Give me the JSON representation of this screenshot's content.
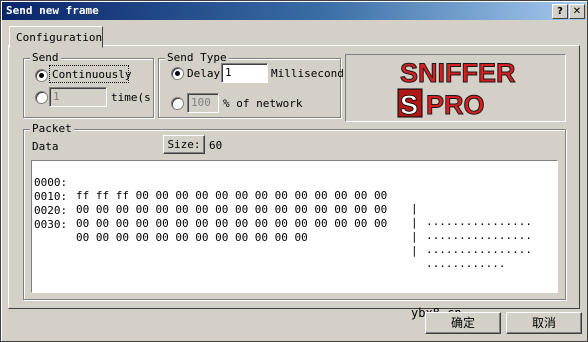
{
  "window": {
    "title": "Send new frame",
    "help_btn": "?",
    "close_btn": "✕"
  },
  "tab": {
    "label": "Configuration"
  },
  "send": {
    "group_label": "Send",
    "continuously_label": "Continuously",
    "count_value": "1",
    "times_label": "time(s"
  },
  "send_type": {
    "group_label": "Send Type",
    "delay_label": "Delay",
    "delay_value": "1",
    "delay_unit": "Millisecond",
    "percent_value": "100",
    "percent_label": "% of network"
  },
  "logo": {
    "line1": "SNIFFER",
    "line2_s": "S",
    "line2_rest": "PRO"
  },
  "packet": {
    "group_label": "Packet",
    "data_label": "Data",
    "size_button": "Size:",
    "size_value": "60",
    "rows": [
      {
        "offset": "0000:",
        "bytes": "ff ff ff 00 00 00 00 00 00 00 00 00 00 00 00 00",
        "sep": "|",
        "ascii": "................"
      },
      {
        "offset": "0010:",
        "bytes": "00 00 00 00 00 00 00 00 00 00 00 00 00 00 00 00",
        "sep": "|",
        "ascii": "................"
      },
      {
        "offset": "0020:",
        "bytes": "00 00 00 00 00 00 00 00 00 00 00 00 00 00 00 00",
        "sep": "|",
        "ascii": "................"
      },
      {
        "offset": "0030:",
        "bytes": "00 00 00 00 00 00 00 00 00 00 00 00",
        "sep": "|",
        "ascii": "............"
      }
    ]
  },
  "watermark": "ybx8.cn",
  "buttons": {
    "ok": "确定",
    "cancel": "取消"
  },
  "colors": {
    "title_start": "#0a246a",
    "title_end": "#a6caf0",
    "logo_red": "#d42020"
  }
}
